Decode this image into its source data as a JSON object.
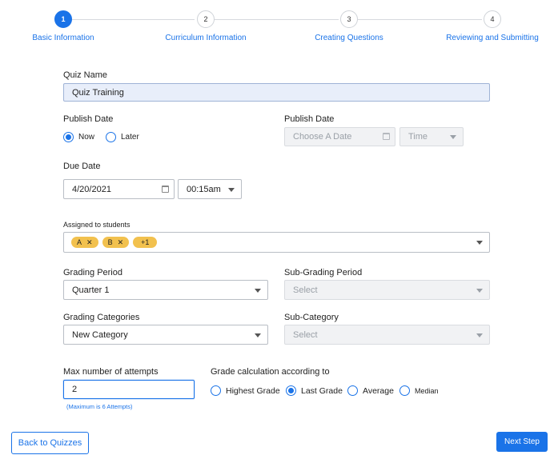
{
  "stepper": {
    "steps": [
      {
        "number": "1",
        "label": "Basic Information"
      },
      {
        "number": "2",
        "label": "Curriculum Information"
      },
      {
        "number": "3",
        "label": "Creating Questions"
      },
      {
        "number": "4",
        "label": "Reviewing and Submitting"
      }
    ],
    "active_step": 1
  },
  "form": {
    "quiz_name": {
      "label": "Quiz Name",
      "value": "Quiz Training"
    },
    "publish_date_mode": {
      "label": "Publish Date",
      "options": [
        "Now",
        "Later"
      ],
      "selected": "Now"
    },
    "publish_date": {
      "label": "Publish Date",
      "date_placeholder": "Choose A Date",
      "time_placeholder": "Time"
    },
    "due_date": {
      "label": "Due Date",
      "date": "4/20/2021",
      "time": "00:15am"
    },
    "assigned": {
      "label": "Assigned to students",
      "chips": [
        "A",
        "B"
      ],
      "more": "+1"
    },
    "grading_period": {
      "label": "Grading Period",
      "value": "Quarter 1"
    },
    "sub_grading_period": {
      "label": "Sub-Grading Period",
      "placeholder": "Select"
    },
    "grading_categories": {
      "label": "Grading Categories",
      "value": "New Category"
    },
    "sub_category": {
      "label": "Sub-Category",
      "placeholder": "Select"
    },
    "max_attempts": {
      "label": "Max number of attempts",
      "value": "2",
      "hint": "(Maximum is 6 Attempts)"
    },
    "grade_calc": {
      "label": "Grade calculation according to",
      "options": [
        "Highest Grade",
        "Last Grade",
        "Average",
        "Median"
      ],
      "selected": "Last Grade"
    }
  },
  "footer": {
    "back_label": "Back to Quizzes",
    "next_label": "Next Step"
  },
  "colors": {
    "accent": "#1a73e8",
    "chip": "#f2c14e",
    "filled_field": "#e8eefa"
  }
}
